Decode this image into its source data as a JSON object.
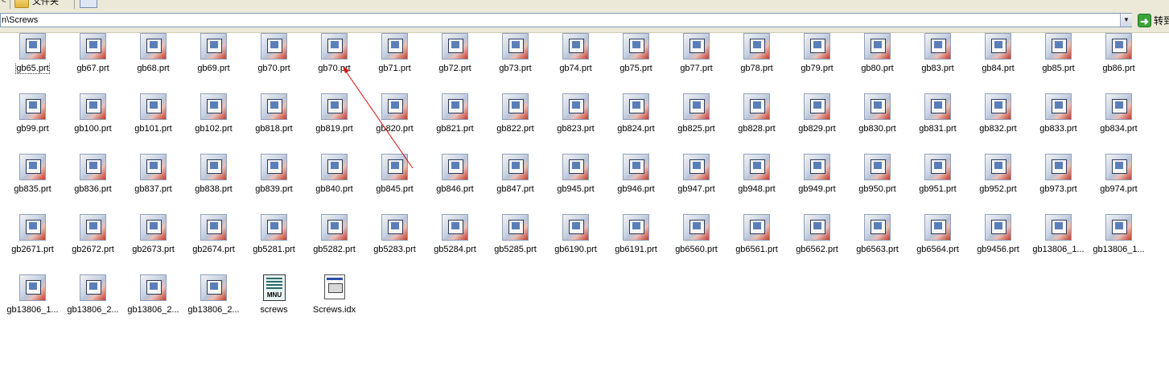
{
  "address": {
    "path": "n\\Screws",
    "go_label": "转到"
  },
  "toolbar": {
    "folder_label": "文件夹"
  },
  "files": [
    {
      "name": "gb65.prt",
      "type": "prt",
      "selected": true
    },
    {
      "name": "gb67.prt",
      "type": "prt"
    },
    {
      "name": "gb68.prt",
      "type": "prt"
    },
    {
      "name": "gb69.prt",
      "type": "prt"
    },
    {
      "name": "gb70.prt",
      "type": "prt"
    },
    {
      "name": "gb70.prt",
      "type": "prt"
    },
    {
      "name": "gb71.prt",
      "type": "prt"
    },
    {
      "name": "gb72.prt",
      "type": "prt"
    },
    {
      "name": "gb73.prt",
      "type": "prt"
    },
    {
      "name": "gb74.prt",
      "type": "prt"
    },
    {
      "name": "gb75.prt",
      "type": "prt"
    },
    {
      "name": "gb77.prt",
      "type": "prt"
    },
    {
      "name": "gb78.prt",
      "type": "prt"
    },
    {
      "name": "gb79.prt",
      "type": "prt"
    },
    {
      "name": "gb80.prt",
      "type": "prt"
    },
    {
      "name": "gb83.prt",
      "type": "prt"
    },
    {
      "name": "gb84.prt",
      "type": "prt"
    },
    {
      "name": "gb85.prt",
      "type": "prt"
    },
    {
      "name": "gb86.prt",
      "type": "prt"
    },
    {
      "name": "gb99.prt",
      "type": "prt"
    },
    {
      "name": "gb100.prt",
      "type": "prt"
    },
    {
      "name": "gb101.prt",
      "type": "prt"
    },
    {
      "name": "gb102.prt",
      "type": "prt"
    },
    {
      "name": "gb818.prt",
      "type": "prt"
    },
    {
      "name": "gb819.prt",
      "type": "prt"
    },
    {
      "name": "gb820.prt",
      "type": "prt"
    },
    {
      "name": "gb821.prt",
      "type": "prt"
    },
    {
      "name": "gb822.prt",
      "type": "prt"
    },
    {
      "name": "gb823.prt",
      "type": "prt"
    },
    {
      "name": "gb824.prt",
      "type": "prt"
    },
    {
      "name": "gb825.prt",
      "type": "prt"
    },
    {
      "name": "gb828.prt",
      "type": "prt"
    },
    {
      "name": "gb829.prt",
      "type": "prt"
    },
    {
      "name": "gb830.prt",
      "type": "prt"
    },
    {
      "name": "gb831.prt",
      "type": "prt"
    },
    {
      "name": "gb832.prt",
      "type": "prt"
    },
    {
      "name": "gb833.prt",
      "type": "prt"
    },
    {
      "name": "gb834.prt",
      "type": "prt"
    },
    {
      "name": "gb835.prt",
      "type": "prt"
    },
    {
      "name": "gb836.prt",
      "type": "prt"
    },
    {
      "name": "gb837.prt",
      "type": "prt"
    },
    {
      "name": "gb838.prt",
      "type": "prt"
    },
    {
      "name": "gb839.prt",
      "type": "prt"
    },
    {
      "name": "gb840.prt",
      "type": "prt"
    },
    {
      "name": "gb845.prt",
      "type": "prt"
    },
    {
      "name": "gb846.prt",
      "type": "prt"
    },
    {
      "name": "gb847.prt",
      "type": "prt"
    },
    {
      "name": "gb945.prt",
      "type": "prt"
    },
    {
      "name": "gb946.prt",
      "type": "prt"
    },
    {
      "name": "gb947.prt",
      "type": "prt"
    },
    {
      "name": "gb948.prt",
      "type": "prt"
    },
    {
      "name": "gb949.prt",
      "type": "prt"
    },
    {
      "name": "gb950.prt",
      "type": "prt"
    },
    {
      "name": "gb951.prt",
      "type": "prt"
    },
    {
      "name": "gb952.prt",
      "type": "prt"
    },
    {
      "name": "gb973.prt",
      "type": "prt"
    },
    {
      "name": "gb974.prt",
      "type": "prt"
    },
    {
      "name": "gb2671.prt",
      "type": "prt"
    },
    {
      "name": "gb2672.prt",
      "type": "prt"
    },
    {
      "name": "gb2673.prt",
      "type": "prt"
    },
    {
      "name": "gb2674.prt",
      "type": "prt"
    },
    {
      "name": "gb5281.prt",
      "type": "prt"
    },
    {
      "name": "gb5282.prt",
      "type": "prt"
    },
    {
      "name": "gb5283.prt",
      "type": "prt"
    },
    {
      "name": "gb5284.prt",
      "type": "prt"
    },
    {
      "name": "gb5285.prt",
      "type": "prt"
    },
    {
      "name": "gb6190.prt",
      "type": "prt"
    },
    {
      "name": "gb6191.prt",
      "type": "prt"
    },
    {
      "name": "gb6560.prt",
      "type": "prt"
    },
    {
      "name": "gb6561.prt",
      "type": "prt"
    },
    {
      "name": "gb6562.prt",
      "type": "prt"
    },
    {
      "name": "gb6563.prt",
      "type": "prt"
    },
    {
      "name": "gb6564.prt",
      "type": "prt"
    },
    {
      "name": "gb9456.prt",
      "type": "prt"
    },
    {
      "name": "gb13806_1...",
      "type": "prt"
    },
    {
      "name": "gb13806_1...",
      "type": "prt"
    },
    {
      "name": "gb13806_1...",
      "type": "prt"
    },
    {
      "name": "gb13806_2...",
      "type": "prt"
    },
    {
      "name": "gb13806_2...",
      "type": "prt"
    },
    {
      "name": "gb13806_2...",
      "type": "prt"
    },
    {
      "name": "screws",
      "type": "mnu",
      "icon_text": "MNU"
    },
    {
      "name": "Screws.idx",
      "type": "idx"
    }
  ]
}
